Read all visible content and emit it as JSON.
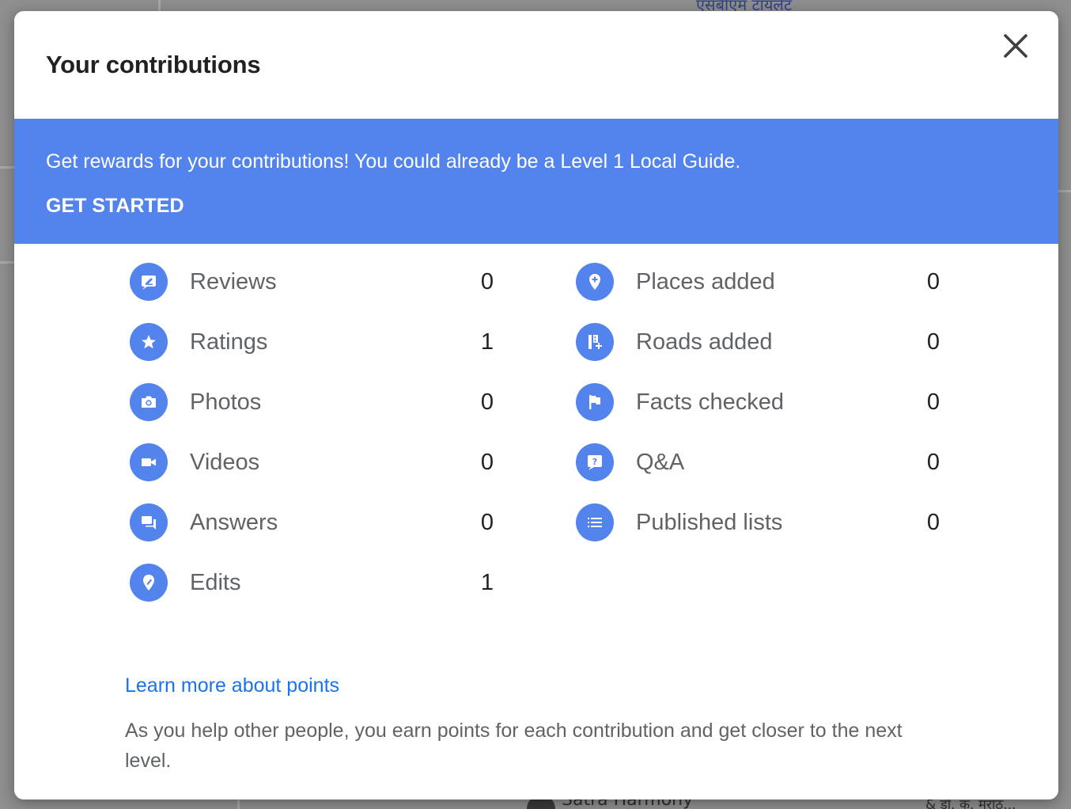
{
  "background_map": {
    "label_top_right": "एसबीएम टायलेट",
    "label_bottom_center": "Satra Harmony",
    "label_bottom_right": "& डॉ. क. मराठ..."
  },
  "dialog": {
    "title": "Your contributions",
    "close_icon": "close-icon"
  },
  "banner": {
    "message": "Get rewards for your contributions! You could already be a Level 1 Local Guide.",
    "cta_label": "GET STARTED",
    "color": "#5383ec"
  },
  "stats_left": [
    {
      "label": "Reviews",
      "value": "0",
      "icon": "review-icon"
    },
    {
      "label": "Ratings",
      "value": "1",
      "icon": "star-icon"
    },
    {
      "label": "Photos",
      "value": "0",
      "icon": "camera-icon"
    },
    {
      "label": "Videos",
      "value": "0",
      "icon": "video-icon"
    },
    {
      "label": "Answers",
      "value": "0",
      "icon": "chat-icon"
    },
    {
      "label": "Edits",
      "value": "1",
      "icon": "edit-pin-icon"
    }
  ],
  "stats_right": [
    {
      "label": "Places added",
      "value": "0",
      "icon": "add-place-icon"
    },
    {
      "label": "Roads added",
      "value": "0",
      "icon": "add-road-icon"
    },
    {
      "label": "Facts checked",
      "value": "0",
      "icon": "flag-icon"
    },
    {
      "label": "Q&A",
      "value": "0",
      "icon": "question-icon"
    },
    {
      "label": "Published lists",
      "value": "0",
      "icon": "list-icon"
    }
  ],
  "footer": {
    "learn_more_label": "Learn more about points",
    "description": "As you help other people, you earn points for each contribution and get closer to the next level."
  },
  "colors": {
    "accent": "#5383ec",
    "link": "#1a73e8",
    "label_text": "#5f6368",
    "value_text": "#202124"
  }
}
